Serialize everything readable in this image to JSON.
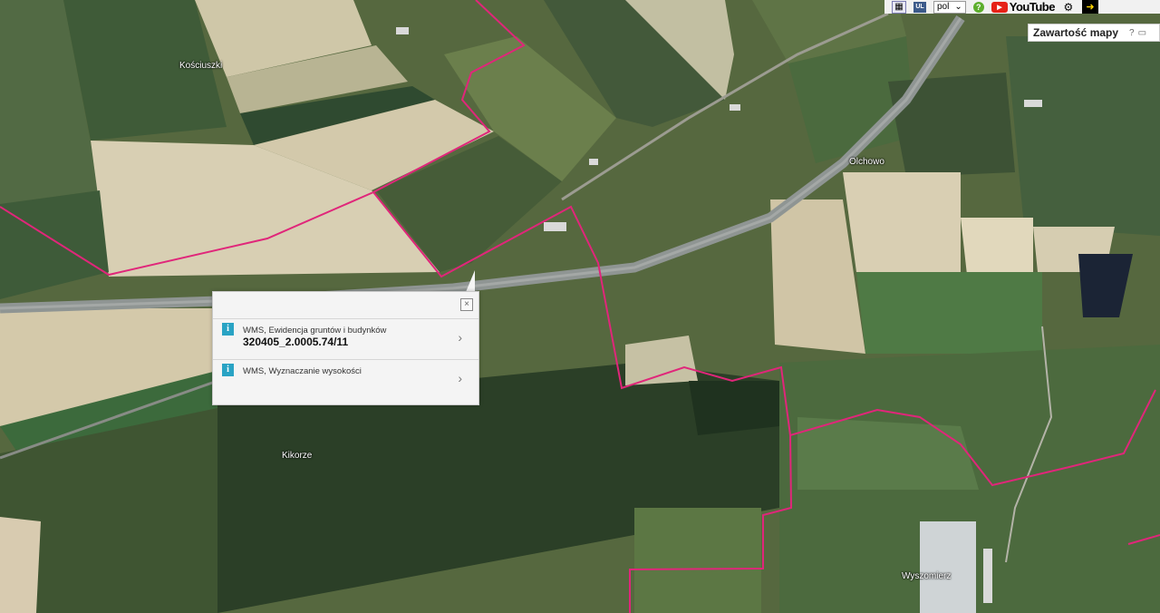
{
  "toolbar": {
    "language": "pol",
    "youtube_label": "YouTube",
    "help_symbol": "?"
  },
  "contents_panel": {
    "label": "Zawartość mapy",
    "help_symbol": "?"
  },
  "popup": {
    "close_symbol": "×",
    "items": [
      {
        "icon": "i",
        "title": "WMS, Ewidencja gruntów i budynków",
        "value": "320405_2.0005.74/11"
      },
      {
        "icon": "i",
        "title": "WMS, Wyznaczanie wysokości",
        "value": ""
      }
    ]
  },
  "places": {
    "kosciuszki": "Kościuszki",
    "olchowo": "Olchowo",
    "kikorze": "Kikorze",
    "wyszomierz": "Wyszomierz"
  },
  "colors": {
    "parcel_boundary": "#e0267a",
    "road": "#8a8f8c",
    "info_icon": "#29a3c4"
  }
}
